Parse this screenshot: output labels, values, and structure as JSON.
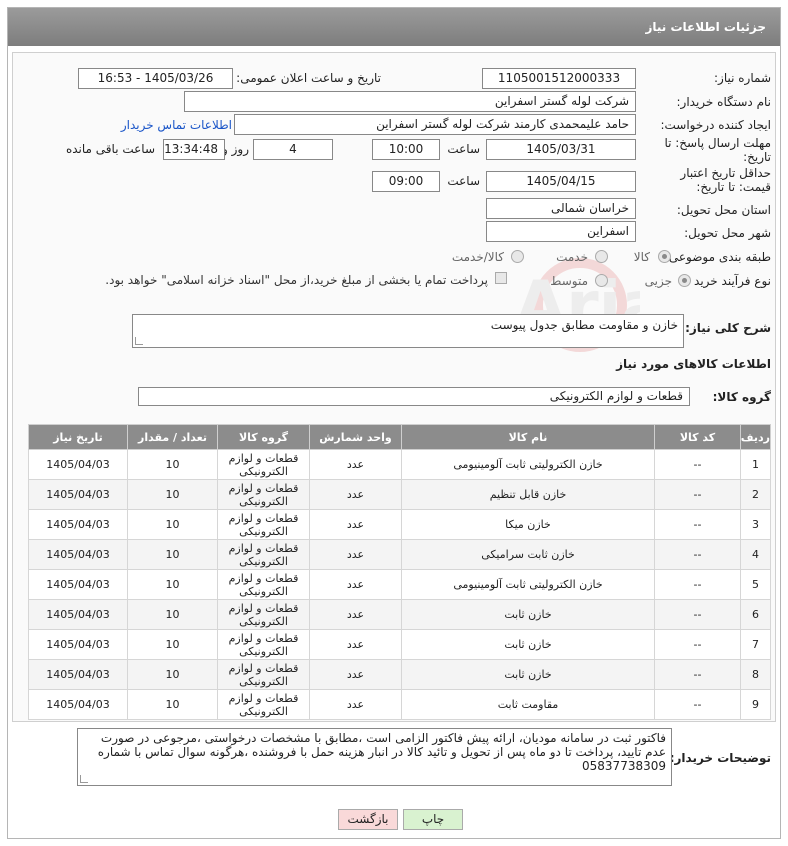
{
  "header": {
    "title": "جزئیات اطلاعات نیاز"
  },
  "form": {
    "need_number_label": "شماره نیاز:",
    "need_number": "1105001512000333",
    "announce_label": "تاریخ و ساعت اعلان عمومی:",
    "announce_value": "1405/03/26 - 16:53",
    "buyer_label": "نام دستگاه خریدار:",
    "buyer_value": "شرکت لوله گستر اسفراین",
    "creator_label": "ایجاد کننده درخواست:",
    "creator_value": "حامد علیمحمدی کارمند شرکت لوله گستر اسفراین",
    "contact_link": "اطلاعات تماس خریدار",
    "deadline_label": "مهلت ارسال پاسخ: تا تاریخ:",
    "deadline_date": "1405/03/31",
    "time_label": "ساعت",
    "deadline_time": "10:00",
    "days_value": "4",
    "days_label": "روز و",
    "remaining_value": "13:34:48",
    "remaining_label": "ساعت باقی مانده",
    "validity_label": "حداقل تاریخ اعتبار قیمت: تا تاریخ:",
    "validity_date": "1405/04/15",
    "validity_time": "09:00",
    "province_label": "استان محل تحویل:",
    "province_value": "خراسان شمالی",
    "city_label": "شهر محل تحویل:",
    "city_value": "اسفراین",
    "category_label": "طبقه بندی موضوعی:",
    "category_options": [
      "کالا",
      "خدمت",
      "کالا/خدمت"
    ],
    "category_selected": "کالا",
    "process_label": "نوع فرآیند خرید :",
    "process_options": [
      "جزیی",
      "متوسط"
    ],
    "process_selected": "جزیی",
    "payment_note": "پرداخت تمام یا بخشی از مبلغ خرید،از محل \"اسناد خزانه اسلامی\" خواهد بود."
  },
  "description": {
    "label": "شرح کلی نیاز:",
    "value": "خازن و مقاومت مطابق جدول پیوست"
  },
  "goods_section": {
    "title": "اطلاعات کالاهای مورد نیاز",
    "group_label": "گروه کالا:",
    "group_value": "قطعات و لوازم الکترونیکی"
  },
  "table": {
    "headers": [
      "ردیف",
      "کد کالا",
      "نام کالا",
      "واحد شمارش",
      "گروه کالا",
      "تعداد / مقدار",
      "تاریخ نیاز"
    ],
    "rows": [
      [
        "1",
        "--",
        "خازن الکترولیتی ثابت آلومینیومی",
        "عدد",
        "قطعات و لوازم الکترونیکی",
        "10",
        "1405/04/03"
      ],
      [
        "2",
        "--",
        "خازن قابل تنظیم",
        "عدد",
        "قطعات و لوازم الکترونیکی",
        "10",
        "1405/04/03"
      ],
      [
        "3",
        "--",
        "خازن میکا",
        "عدد",
        "قطعات و لوازم الکترونیکی",
        "10",
        "1405/04/03"
      ],
      [
        "4",
        "--",
        "خازن ثابت سرامیکی",
        "عدد",
        "قطعات و لوازم الکترونیکی",
        "10",
        "1405/04/03"
      ],
      [
        "5",
        "--",
        "خازن الکترولیتی ثابت آلومینیومی",
        "عدد",
        "قطعات و لوازم الکترونیکی",
        "10",
        "1405/04/03"
      ],
      [
        "6",
        "--",
        "خازن ثابت",
        "عدد",
        "قطعات و لوازم الکترونیکی",
        "10",
        "1405/04/03"
      ],
      [
        "7",
        "--",
        "خازن ثابت",
        "عدد",
        "قطعات و لوازم الکترونیکی",
        "10",
        "1405/04/03"
      ],
      [
        "8",
        "--",
        "خازن ثابت",
        "عدد",
        "قطعات و لوازم الکترونیکی",
        "10",
        "1405/04/03"
      ],
      [
        "9",
        "--",
        "مقاومت ثابت",
        "عدد",
        "قطعات و لوازم الکترونیکی",
        "10",
        "1405/04/03"
      ]
    ]
  },
  "buyer_notes": {
    "label": "توضیحات خریدار:",
    "value": "فاکتور ثبت در سامانه مودیان، ارائه پیش فاکتور الزامی است ،مطابق با مشخصات درخواستی ،مرجوعی در صورت عدم تایید، پرداخت تا دو ماه پس از تحویل و تائید کالا در انبار  هزینه حمل با فروشنده ،هرگونه سوال تماس با شماره 05837738309"
  },
  "buttons": {
    "print": "چاپ",
    "back": "بازگشت"
  },
  "watermark": "AriaTender.neT",
  "colors": {
    "title_bg": "#8c8c8c",
    "link": "#1a55c8",
    "print_btn": "#d9f2d0",
    "back_btn": "#f9d9d9"
  }
}
